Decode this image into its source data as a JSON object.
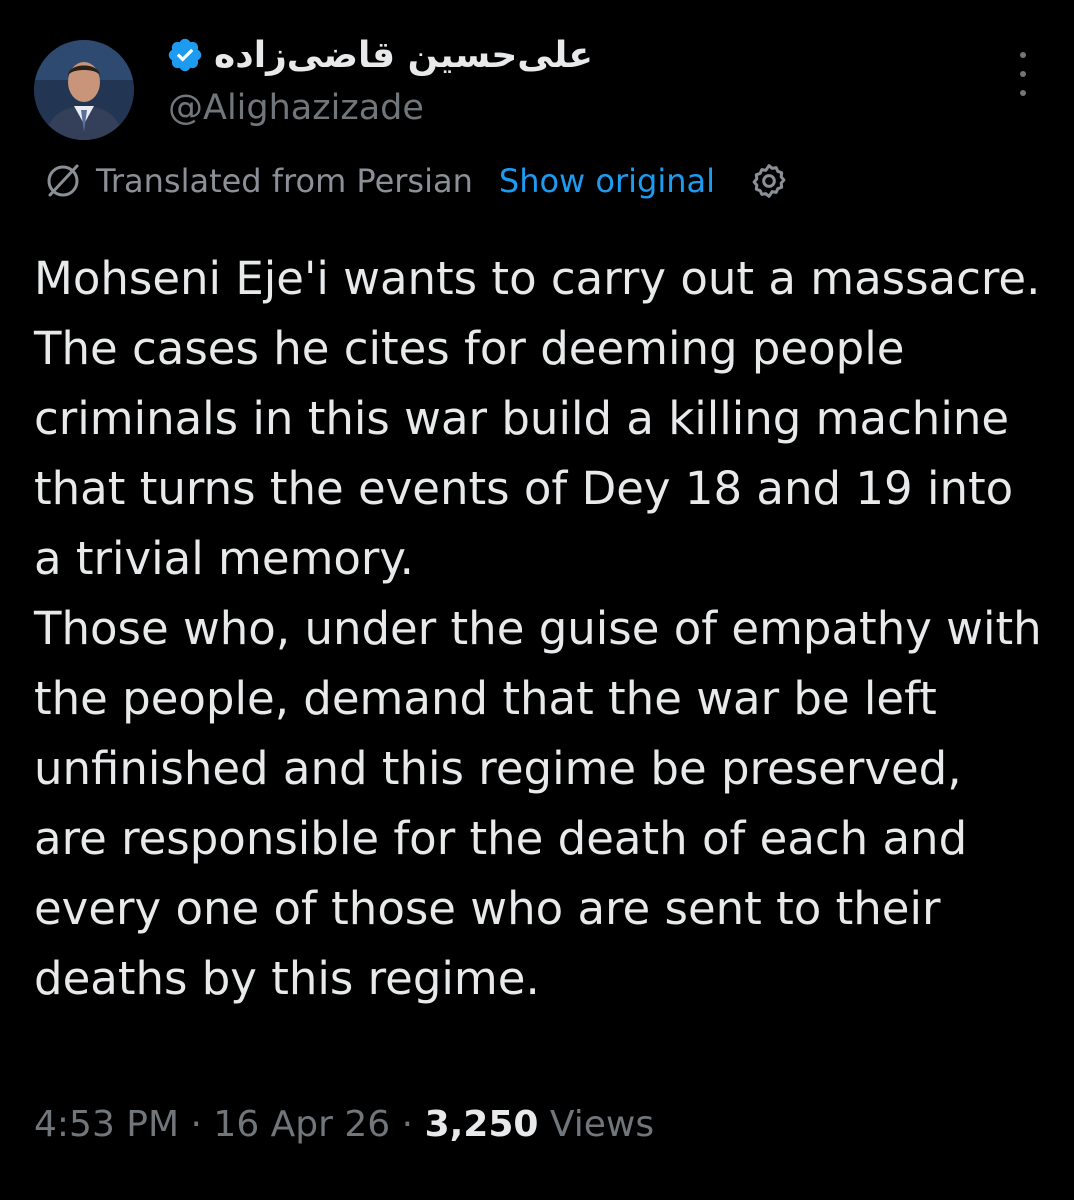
{
  "author": {
    "display_name": "علی‌حسین قاضی‌زاده",
    "handle": "@Alighazizade",
    "verified": true,
    "verified_color": "#1d9bf0"
  },
  "translation": {
    "label": "Translated from Persian",
    "action": "Show original",
    "icon": "globe-icon",
    "settings_icon": "gear-icon",
    "link_color": "#1d9bf0"
  },
  "post": {
    "text": "Mohseni Eje'i wants to carry out a massacre. The cases he cites for deeming people criminals in this war build a killing machine that turns the events of Dey 18 and 19 into a trivial memory.\nThose who, under the guise of empathy with the people, demand that the war be left unfinished and this regime be preserved, are responsible for the death of each and every one of those who are sent to their deaths by this regime."
  },
  "meta": {
    "time": "4:53 PM",
    "separator": "·",
    "date": "16 Apr 26",
    "views_count": "3,250",
    "views_label": "Views"
  }
}
